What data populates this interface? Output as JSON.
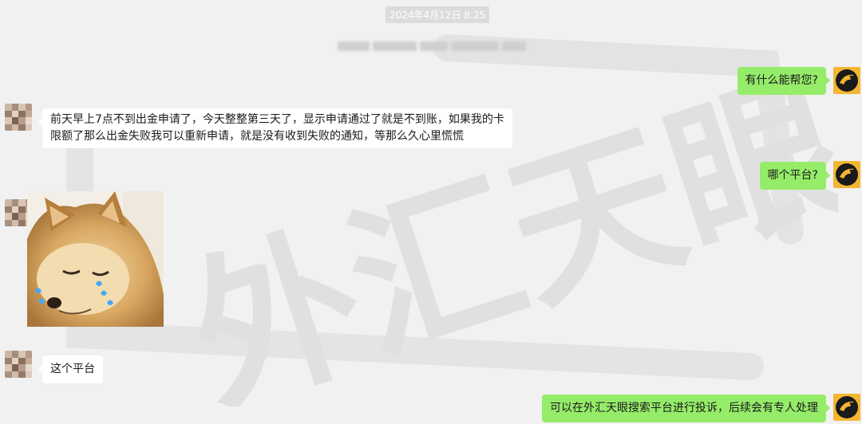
{
  "chat": {
    "timestamp": "2024年4月12日 8:25",
    "watermark_text": "外汇天眼",
    "messages": [
      {
        "sender": "agent",
        "text": "有什么能帮您?"
      },
      {
        "sender": "customer",
        "lines": [
          "前天早上7点不到出金申请了，今天整整第三天了，显示申请通过了就是不到账，如果我的卡",
          "限额了那么出金失败我可以重新申请，就是没有收到失败的通知，等那么久心里慌慌"
        ]
      },
      {
        "sender": "agent",
        "text": "哪个平台?"
      },
      {
        "sender": "customer",
        "type": "sticker",
        "description_icon": "crying-dog-sticker"
      },
      {
        "sender": "customer",
        "text": "这个平台"
      },
      {
        "sender": "agent",
        "text": "可以在外汇天眼搜索平台进行投诉，后续会有专人处理"
      }
    ]
  },
  "colors": {
    "background": "#f1f1f1",
    "outgoing_bubble": "#95ec69",
    "incoming_bubble": "#ffffff",
    "agent_avatar": "#f2b632"
  }
}
